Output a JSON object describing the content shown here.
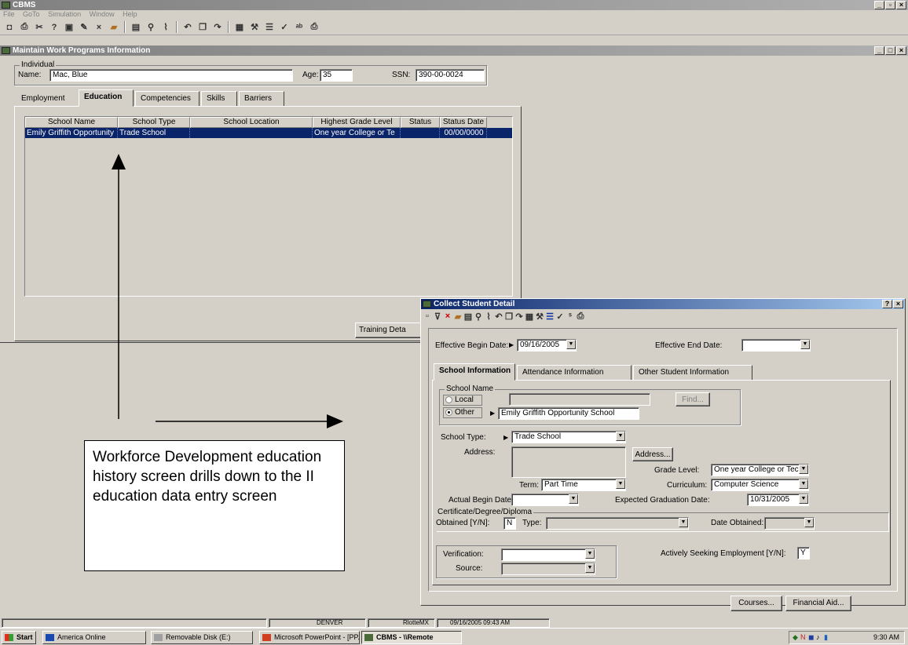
{
  "app": {
    "title": "CBMS",
    "menu": [
      "File",
      "GoTo",
      "Simulation",
      "Window",
      "Help"
    ],
    "toolbar_icons": [
      "new-icon",
      "print-icon",
      "cut-icon",
      "help-icon",
      "info-icon",
      "edit-icon",
      "delete-icon",
      "open-folder-icon",
      "save-icon",
      "find-icon",
      "attach-icon",
      "undo-icon",
      "copy-icon",
      "redo-icon",
      "calendar-icon",
      "tools-icon",
      "list-icon",
      "check-icon",
      "spell-icon",
      "printer-icon"
    ]
  },
  "main_window": {
    "title": "Maintain Work Programs Information",
    "individual_group": "Individual",
    "name_label": "Name:",
    "name_value": "Mac, Blue",
    "age_label": "Age:",
    "age_value": "35",
    "ssn_label": "SSN:",
    "ssn_value": "390-00-0024",
    "tabs": [
      "Employment",
      "Education",
      "Competencies",
      "Skills",
      "Barriers"
    ],
    "active_tab": "Education",
    "grid": {
      "columns": [
        "School Name",
        "School Type",
        "School Location",
        "Highest Grade Level",
        "Status",
        "Status Date"
      ],
      "rows": [
        [
          "Emily Griffith Opportunity",
          "Trade School",
          "",
          "One year College or Te",
          "",
          "00/00/0000"
        ]
      ]
    },
    "training_button": "Training Deta"
  },
  "annotation": {
    "text": "Workforce Development education history screen drills down to the II education data entry screen"
  },
  "dialog": {
    "title": "Collect Student Detail",
    "toolbar_icons": [
      "new-icon",
      "filter-icon",
      "delete-icon",
      "folder-icon",
      "save-icon",
      "find-icon",
      "attach-icon",
      "undo-icon",
      "doc-icon",
      "redo-icon",
      "calendar-icon",
      "tools-icon",
      "list-icon",
      "check-icon",
      "spell-icon",
      "print-icon"
    ],
    "effective_begin_label": "Effective Begin Date:",
    "effective_begin_value": "09/16/2005",
    "effective_end_label": "Effective End Date:",
    "effective_end_value": "",
    "tabs": [
      "School Information",
      "Attendance Information",
      "Other Student Information"
    ],
    "school_name_group": "School Name",
    "local_label": "Local",
    "other_label": "Other",
    "local_value": "",
    "find_button": "Find...",
    "other_value": "Emily Griffith Opportunity School",
    "school_type_label": "School Type:",
    "school_type_value": "Trade School",
    "address_label": "Address:",
    "address_button": "Address...",
    "grade_level_label": "Grade Level:",
    "grade_level_value": "One year College or Tech Sc",
    "term_label": "Term:",
    "term_value": "Part Time",
    "curriculum_label": "Curriculum:",
    "curriculum_value": "Computer Science",
    "actual_begin_label": "Actual Begin Date:",
    "actual_begin_value": "",
    "expected_grad_label": "Expected Graduation Date:",
    "expected_grad_value": "10/31/2005",
    "certificate_group": "Certificate/Degree/Diploma",
    "obtained_label": "Obtained [Y/N]:",
    "obtained_value": "N",
    "type_label": "Type:",
    "type_value": "",
    "date_obtained_label": "Date Obtained:",
    "date_obtained_value": "",
    "verification_label": "Verification:",
    "verification_value": "",
    "source_label": "Source:",
    "source_value": "",
    "actively_seeking_label": "Actively Seeking Employment [Y/N]:",
    "actively_seeking_value": "Y",
    "courses_button": "Courses...",
    "financial_aid_button": "Financial Aid..."
  },
  "statusbar": {
    "panel1": "",
    "panel2": "DENVER",
    "panel3": "RlotteMX",
    "panel4": "09/16/2005 09:43 AM"
  },
  "taskbar": {
    "start": "Start",
    "items": [
      "America Online",
      "Removable Disk (E:)",
      "Microsoft PowerPoint - [PP...",
      "CBMS - \\\\Remote"
    ],
    "clock": "9:30 AM"
  }
}
